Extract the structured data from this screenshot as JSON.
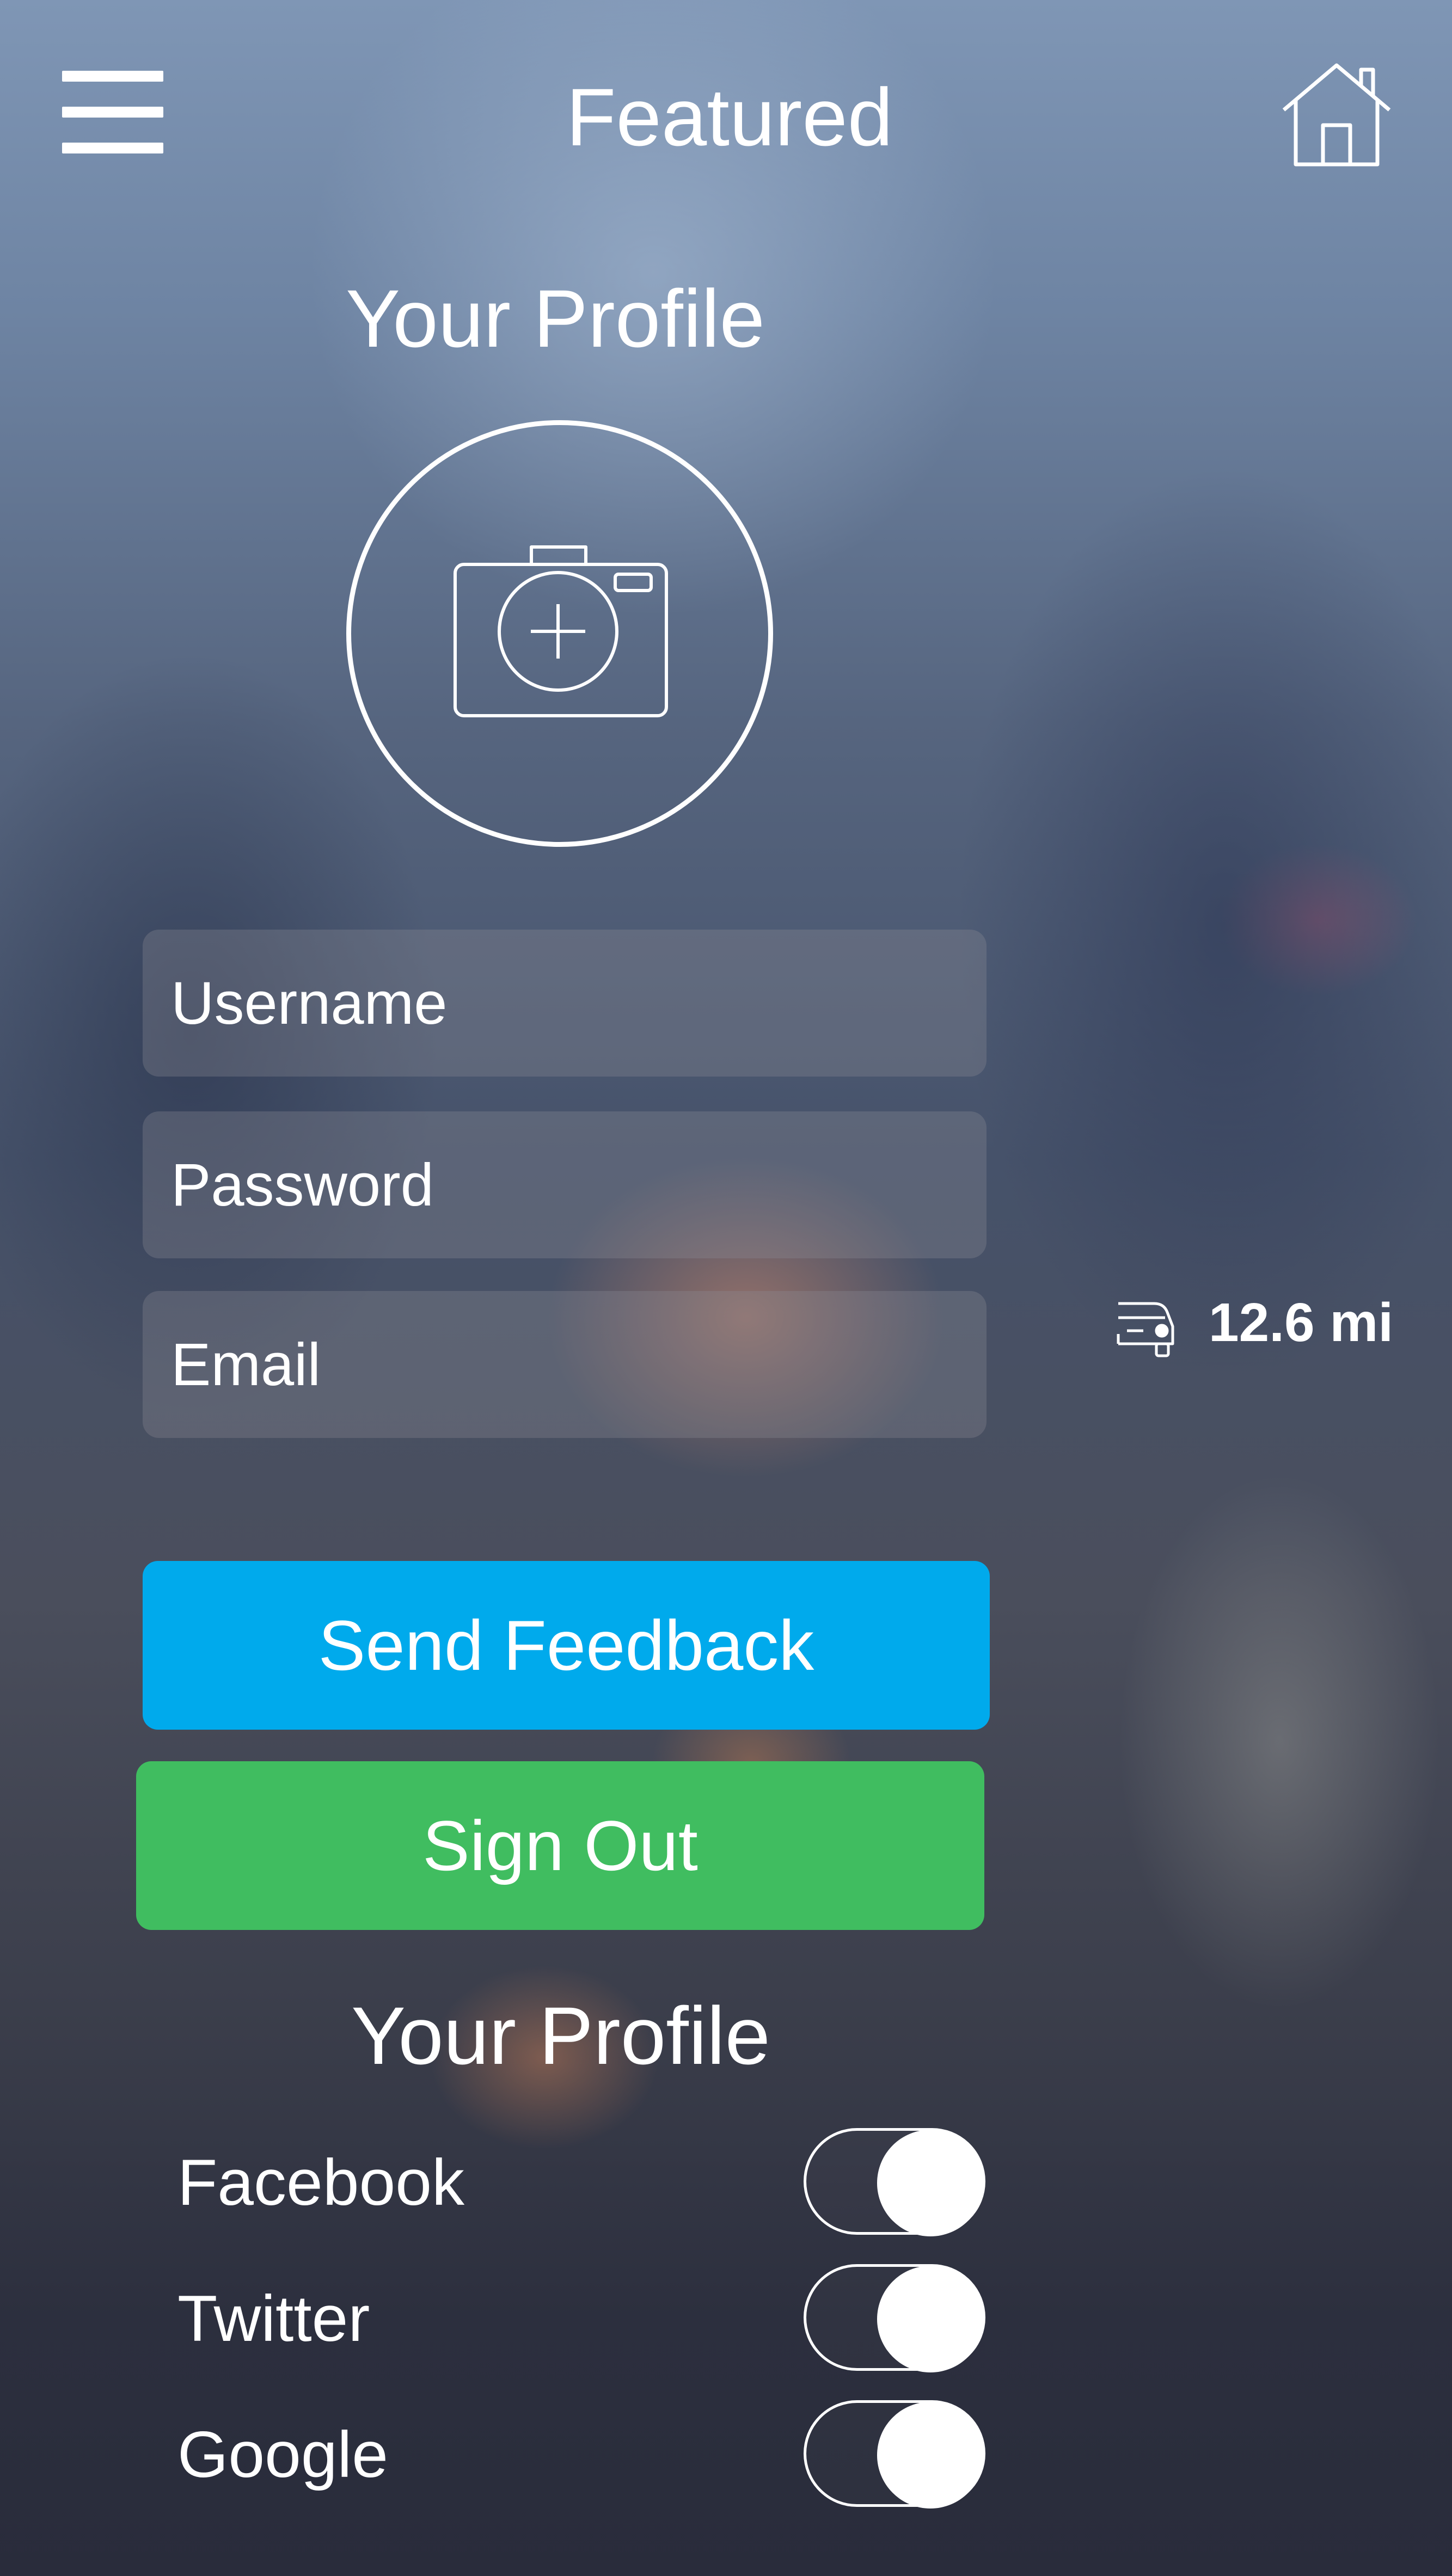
{
  "header": {
    "title": "Featured",
    "menu_icon": "hamburger-menu-icon",
    "home_icon": "home-icon"
  },
  "profile": {
    "title": "Your Profile",
    "photo_icon": "camera-add-icon"
  },
  "form": {
    "username_placeholder": "Username",
    "password_placeholder": "Password",
    "email_placeholder": "Email"
  },
  "distance": {
    "icon": "car-icon",
    "value": "12.6 mi"
  },
  "buttons": {
    "feedback_label": "Send Feedback",
    "signout_label": "Sign Out"
  },
  "social": {
    "title": "Your Profile",
    "items": [
      {
        "label": "Facebook",
        "enabled": true
      },
      {
        "label": "Twitter",
        "enabled": true
      },
      {
        "label": "Google",
        "enabled": true
      }
    ]
  },
  "colors": {
    "feedback_button": "#00aaec",
    "signout_button": "#40bd60",
    "text": "#ffffff"
  }
}
